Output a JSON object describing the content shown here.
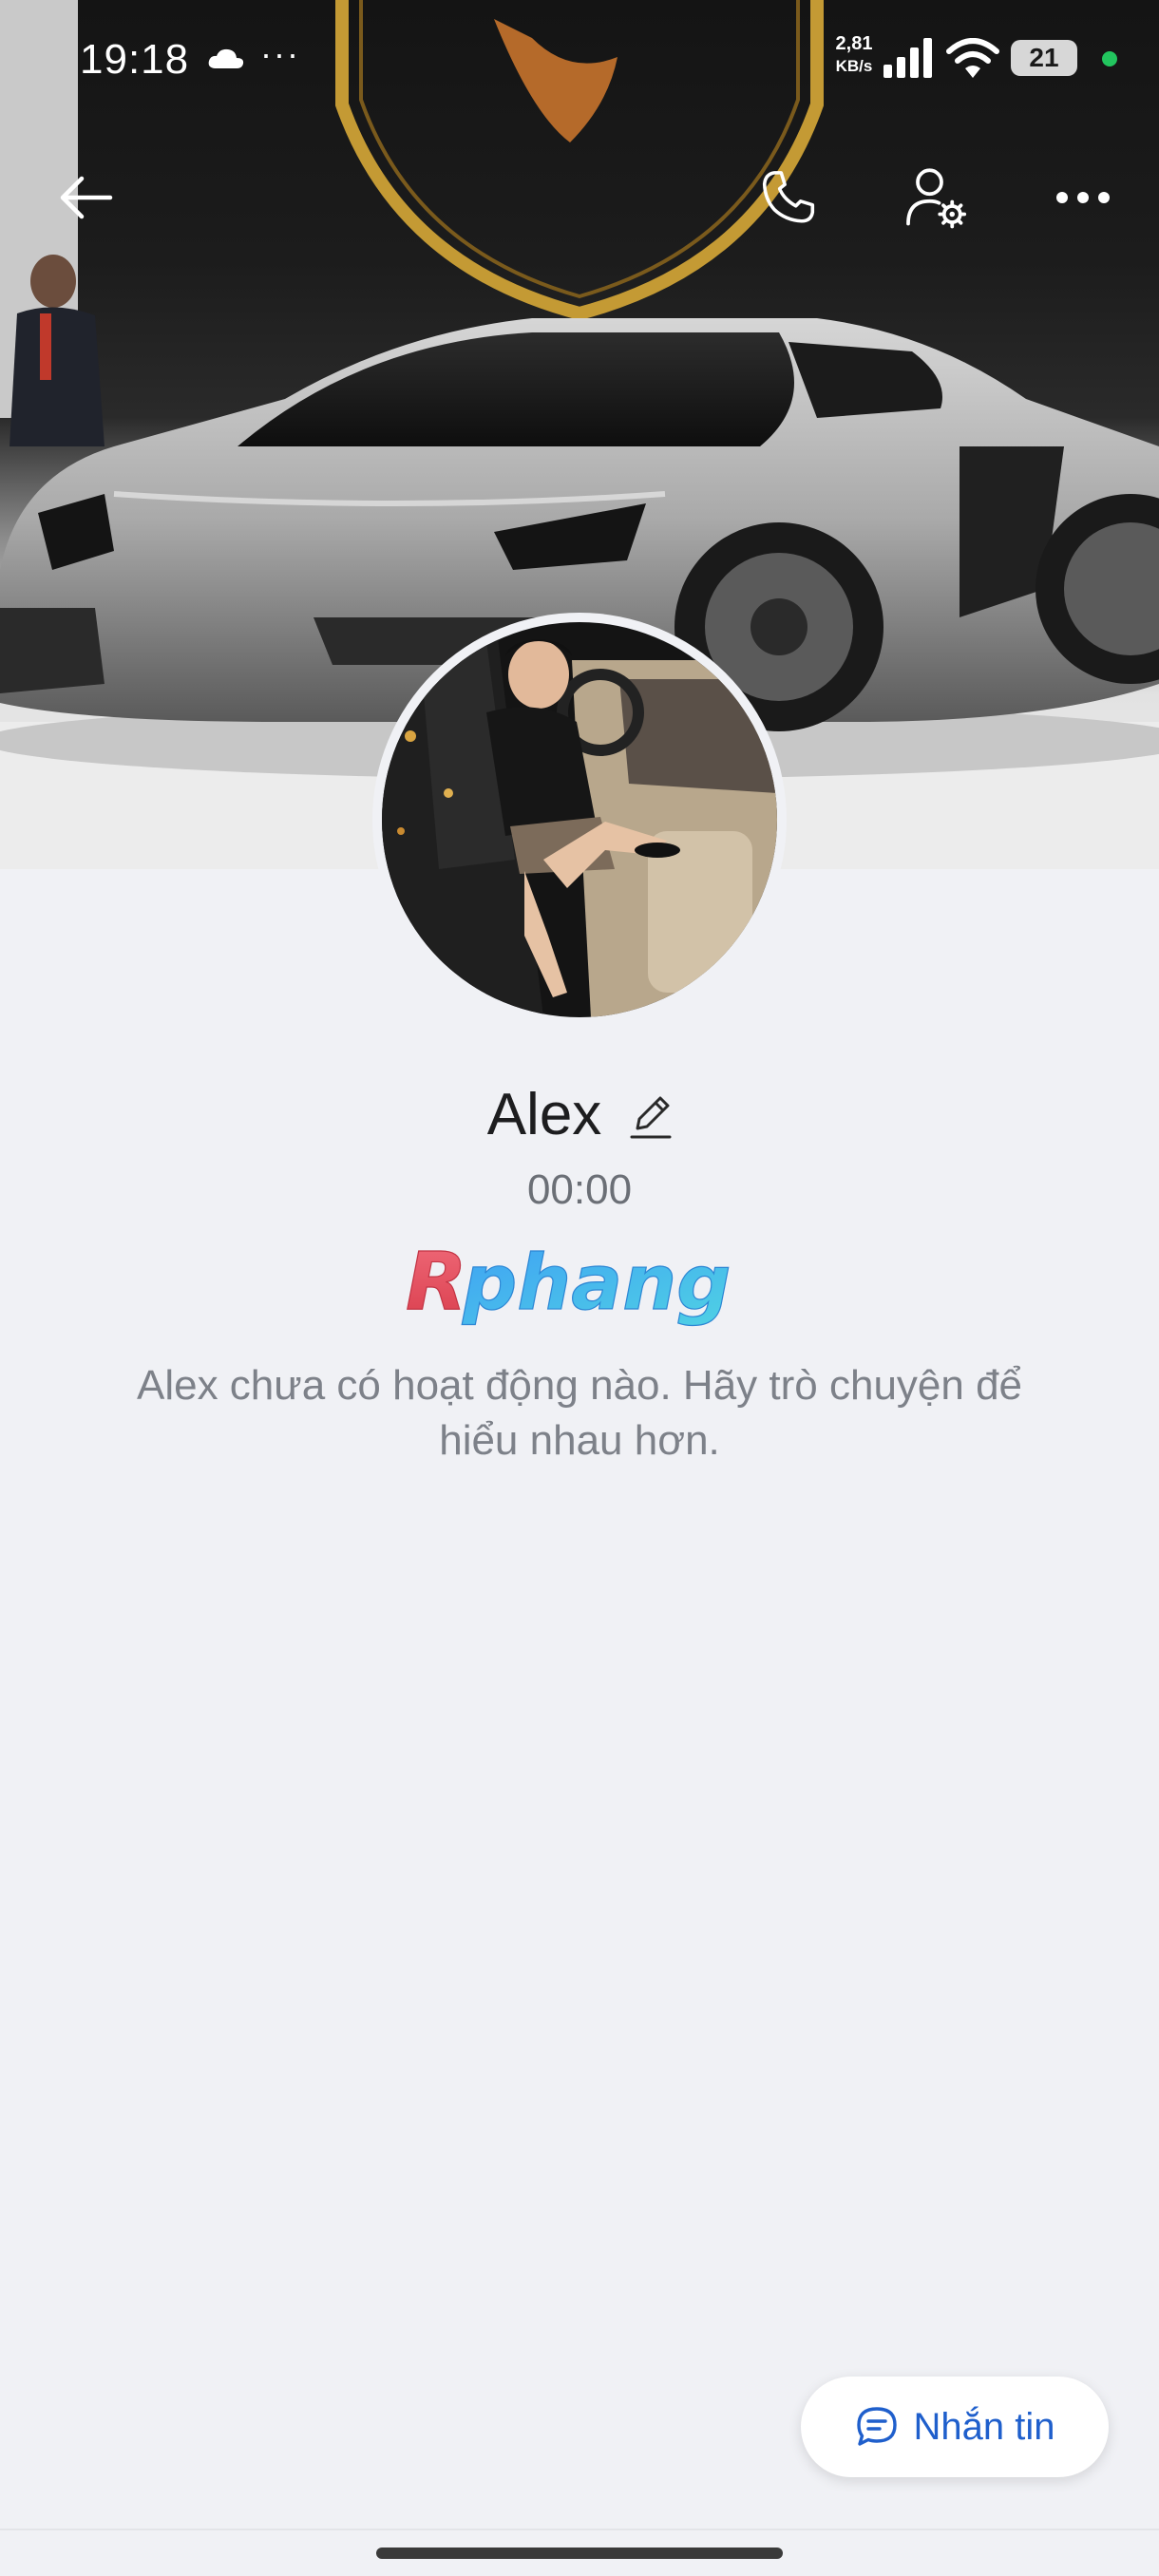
{
  "status_bar": {
    "time": "19:18",
    "more_dots": "···",
    "net_speed_value": "2,81",
    "net_speed_unit": "KB/s",
    "battery_level": "21"
  },
  "profile": {
    "name": "Alex",
    "time": "00:00",
    "empty_message": "Alex chưa có hoạt động nào. Hãy trò chuyện để hiểu nhau hơn.",
    "watermark": "Rphang"
  },
  "actions": {
    "message_label": "Nhắn tin"
  },
  "icons": {
    "back": "arrow-left",
    "call": "phone",
    "profile_settings": "user-gear",
    "more": "ellipsis-horizontal",
    "edit": "pencil",
    "message": "chat-bubble"
  },
  "colors": {
    "background": "#f0f1f5",
    "accent": "#1f5fcc",
    "status_dot": "#22c55e"
  }
}
